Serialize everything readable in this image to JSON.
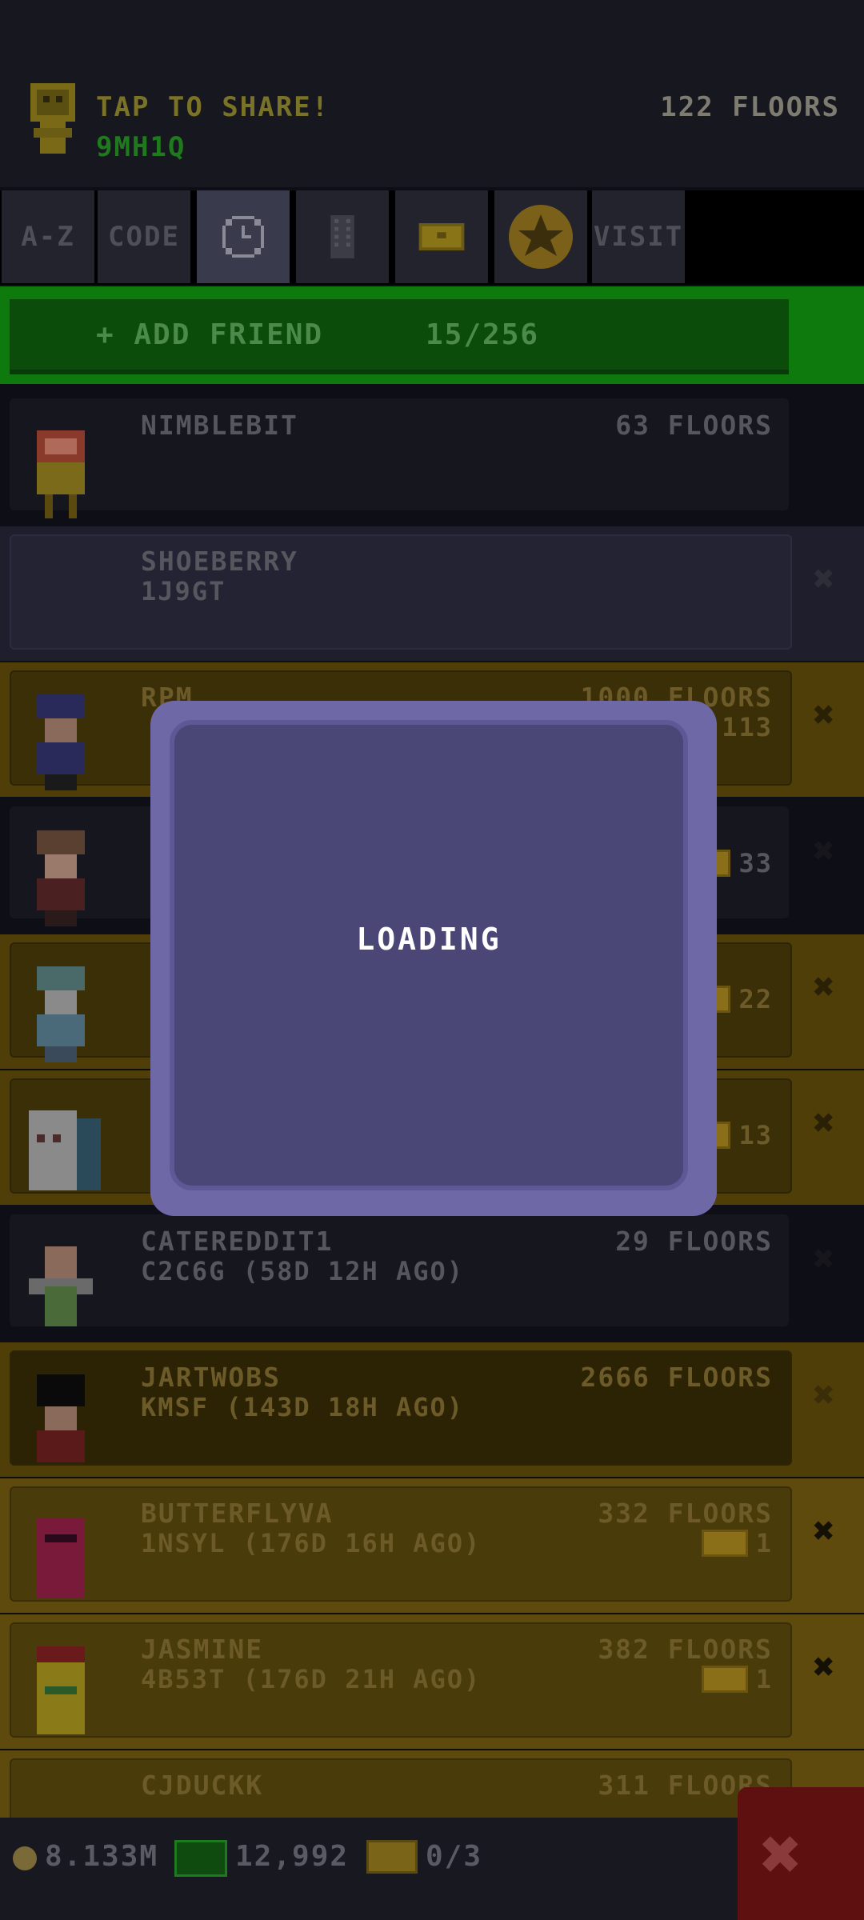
{
  "header": {
    "share_label": "TAP TO SHARE!",
    "player_code": "9MH1Q",
    "floors": "122 FLOORS"
  },
  "tabs": [
    {
      "label": "A-Z",
      "icon": null
    },
    {
      "label": "CODE",
      "icon": null
    },
    {
      "label": "",
      "icon": "clock-icon"
    },
    {
      "label": "",
      "icon": "building-icon"
    },
    {
      "label": "",
      "icon": "ticket-icon"
    },
    {
      "label": "",
      "icon": "star-icon"
    },
    {
      "label": "VISIT",
      "icon": null
    }
  ],
  "add_friend": {
    "label": "+ ADD FRIEND",
    "count": "15/256"
  },
  "friends": [
    {
      "name": "NIMBLEBIT",
      "sub": "",
      "floors": "63 FLOORS",
      "badge": "",
      "style": "dark"
    },
    {
      "name": "SHOEBERRY",
      "sub": "1J9GT",
      "floors": "",
      "badge": "",
      "style": "darkpurple"
    },
    {
      "name": "RPM",
      "sub": "",
      "floors": "1000 FLOORS",
      "badge": "113",
      "style": "gold"
    },
    {
      "name": "",
      "sub": "",
      "floors": "",
      "badge": "33",
      "style": "dark"
    },
    {
      "name": "",
      "sub": "",
      "floors": "",
      "badge": "22",
      "style": "gold"
    },
    {
      "name": "",
      "sub": "",
      "floors": "",
      "badge": "13",
      "style": "gold"
    },
    {
      "name": "CATEREDDIT1",
      "sub": "C2C6G (58D 12H AGO)",
      "floors": "29 FLOORS",
      "badge": "",
      "style": "dark"
    },
    {
      "name": "JARTWOBS",
      "sub": "KMSF (143D 18H AGO)",
      "floors": "2666 FLOORS",
      "badge": "",
      "style": "gold"
    },
    {
      "name": "BUTTERFLYVA",
      "sub": "1NSYL (176D 16H AGO)",
      "floors": "332 FLOORS",
      "badge": "1",
      "style": "gold2"
    },
    {
      "name": "JASMINE",
      "sub": "4B53T (176D 21H AGO)",
      "floors": "382 FLOORS",
      "badge": "1",
      "style": "gold2"
    },
    {
      "name": "CJDUCKK",
      "sub": "",
      "floors": "311 FLOORS",
      "badge": "",
      "style": "gold2"
    }
  ],
  "modal": {
    "text": "LOADING"
  },
  "footer": {
    "coins": "8.133M",
    "bux": "12,992",
    "tickets": "0/3",
    "close_icon": "close-icon"
  }
}
